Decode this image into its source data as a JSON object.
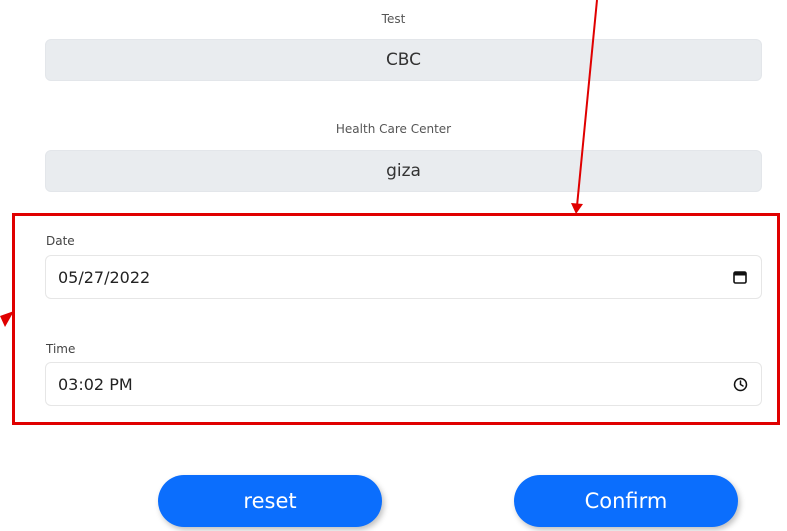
{
  "test": {
    "label": "Test",
    "value": "CBC"
  },
  "center": {
    "label": "Health Care Center",
    "value": "giza"
  },
  "date": {
    "label": "Date",
    "value": "05/27/2022",
    "icon": "calendar-icon"
  },
  "time": {
    "label": "Time",
    "value": "03:02 PM",
    "icon": "clock-icon"
  },
  "buttons": {
    "reset": "reset",
    "confirm": "Confirm"
  },
  "colors": {
    "accent": "#0b6efd",
    "annotation": "#e00000",
    "readonly_bg": "#e9ecef"
  }
}
